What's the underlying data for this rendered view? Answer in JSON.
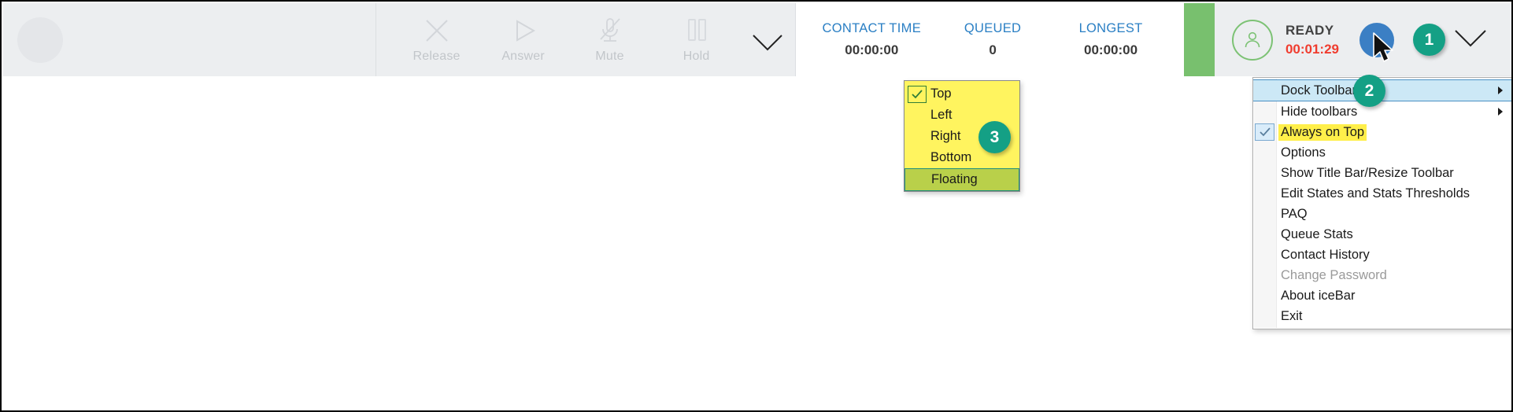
{
  "toolbar": {
    "avatar_placeholder": "agent-photo-placeholder",
    "actions": [
      {
        "label": "Release",
        "icon": "close-x-icon"
      },
      {
        "label": "Answer",
        "icon": "play-triangle-icon"
      },
      {
        "label": "Mute",
        "icon": "microphone-muted-icon"
      },
      {
        "label": "Hold",
        "icon": "pause-bars-icon"
      }
    ],
    "actions_overflow_icon": "chevron-down-icon",
    "stats": [
      {
        "label": "CONTACT TIME",
        "value": "00:00:00"
      },
      {
        "label": "QUEUED",
        "value": "0"
      },
      {
        "label": "LONGEST",
        "value": "00:00:00"
      }
    ],
    "status": {
      "state": "READY",
      "timer": "00:01:29",
      "bar_color": "#78c06e",
      "timer_color": "#f03c2e",
      "avatar_icon": "user-circle-icon"
    },
    "right": {
      "blue_dot_color": "#3b7fc4",
      "menu_chevron_icon": "chevron-down-icon",
      "cursor_icon": "mouse-pointer-icon"
    }
  },
  "callouts": [
    {
      "number": "1"
    },
    {
      "number": "2"
    },
    {
      "number": "3"
    }
  ],
  "context_menu": {
    "items": [
      {
        "label": "Dock Toolbar",
        "highlight": "blue",
        "submenu": true,
        "checked": false,
        "disabled": false
      },
      {
        "label": "Hide toolbars",
        "highlight": "none",
        "submenu": true,
        "checked": false,
        "disabled": false
      },
      {
        "label": "Always on Top",
        "highlight": "yellow",
        "submenu": false,
        "checked": true,
        "disabled": false
      },
      {
        "label": "Options",
        "highlight": "none",
        "submenu": false,
        "checked": false,
        "disabled": false
      },
      {
        "label": "Show Title Bar/Resize Toolbar",
        "highlight": "none",
        "submenu": false,
        "checked": false,
        "disabled": false
      },
      {
        "label": "Edit States and Stats Thresholds",
        "highlight": "none",
        "submenu": false,
        "checked": false,
        "disabled": false
      },
      {
        "label": "PAQ",
        "highlight": "none",
        "submenu": false,
        "checked": false,
        "disabled": false
      },
      {
        "label": "Queue Stats",
        "highlight": "none",
        "submenu": false,
        "checked": false,
        "disabled": false
      },
      {
        "label": "Contact History",
        "highlight": "none",
        "submenu": false,
        "checked": false,
        "disabled": false
      },
      {
        "label": "Change Password",
        "highlight": "none",
        "submenu": false,
        "checked": false,
        "disabled": true
      },
      {
        "label": "About iceBar",
        "highlight": "none",
        "submenu": false,
        "checked": false,
        "disabled": false
      },
      {
        "label": "Exit",
        "highlight": "none",
        "submenu": false,
        "checked": false,
        "disabled": false
      }
    ]
  },
  "dock_submenu": {
    "items": [
      {
        "label": "Top",
        "checked": true,
        "selected": false
      },
      {
        "label": "Left",
        "checked": false,
        "selected": false
      },
      {
        "label": "Right",
        "checked": false,
        "selected": false
      },
      {
        "label": "Bottom",
        "checked": false,
        "selected": false
      },
      {
        "label": "Floating",
        "checked": false,
        "selected": true
      }
    ]
  }
}
